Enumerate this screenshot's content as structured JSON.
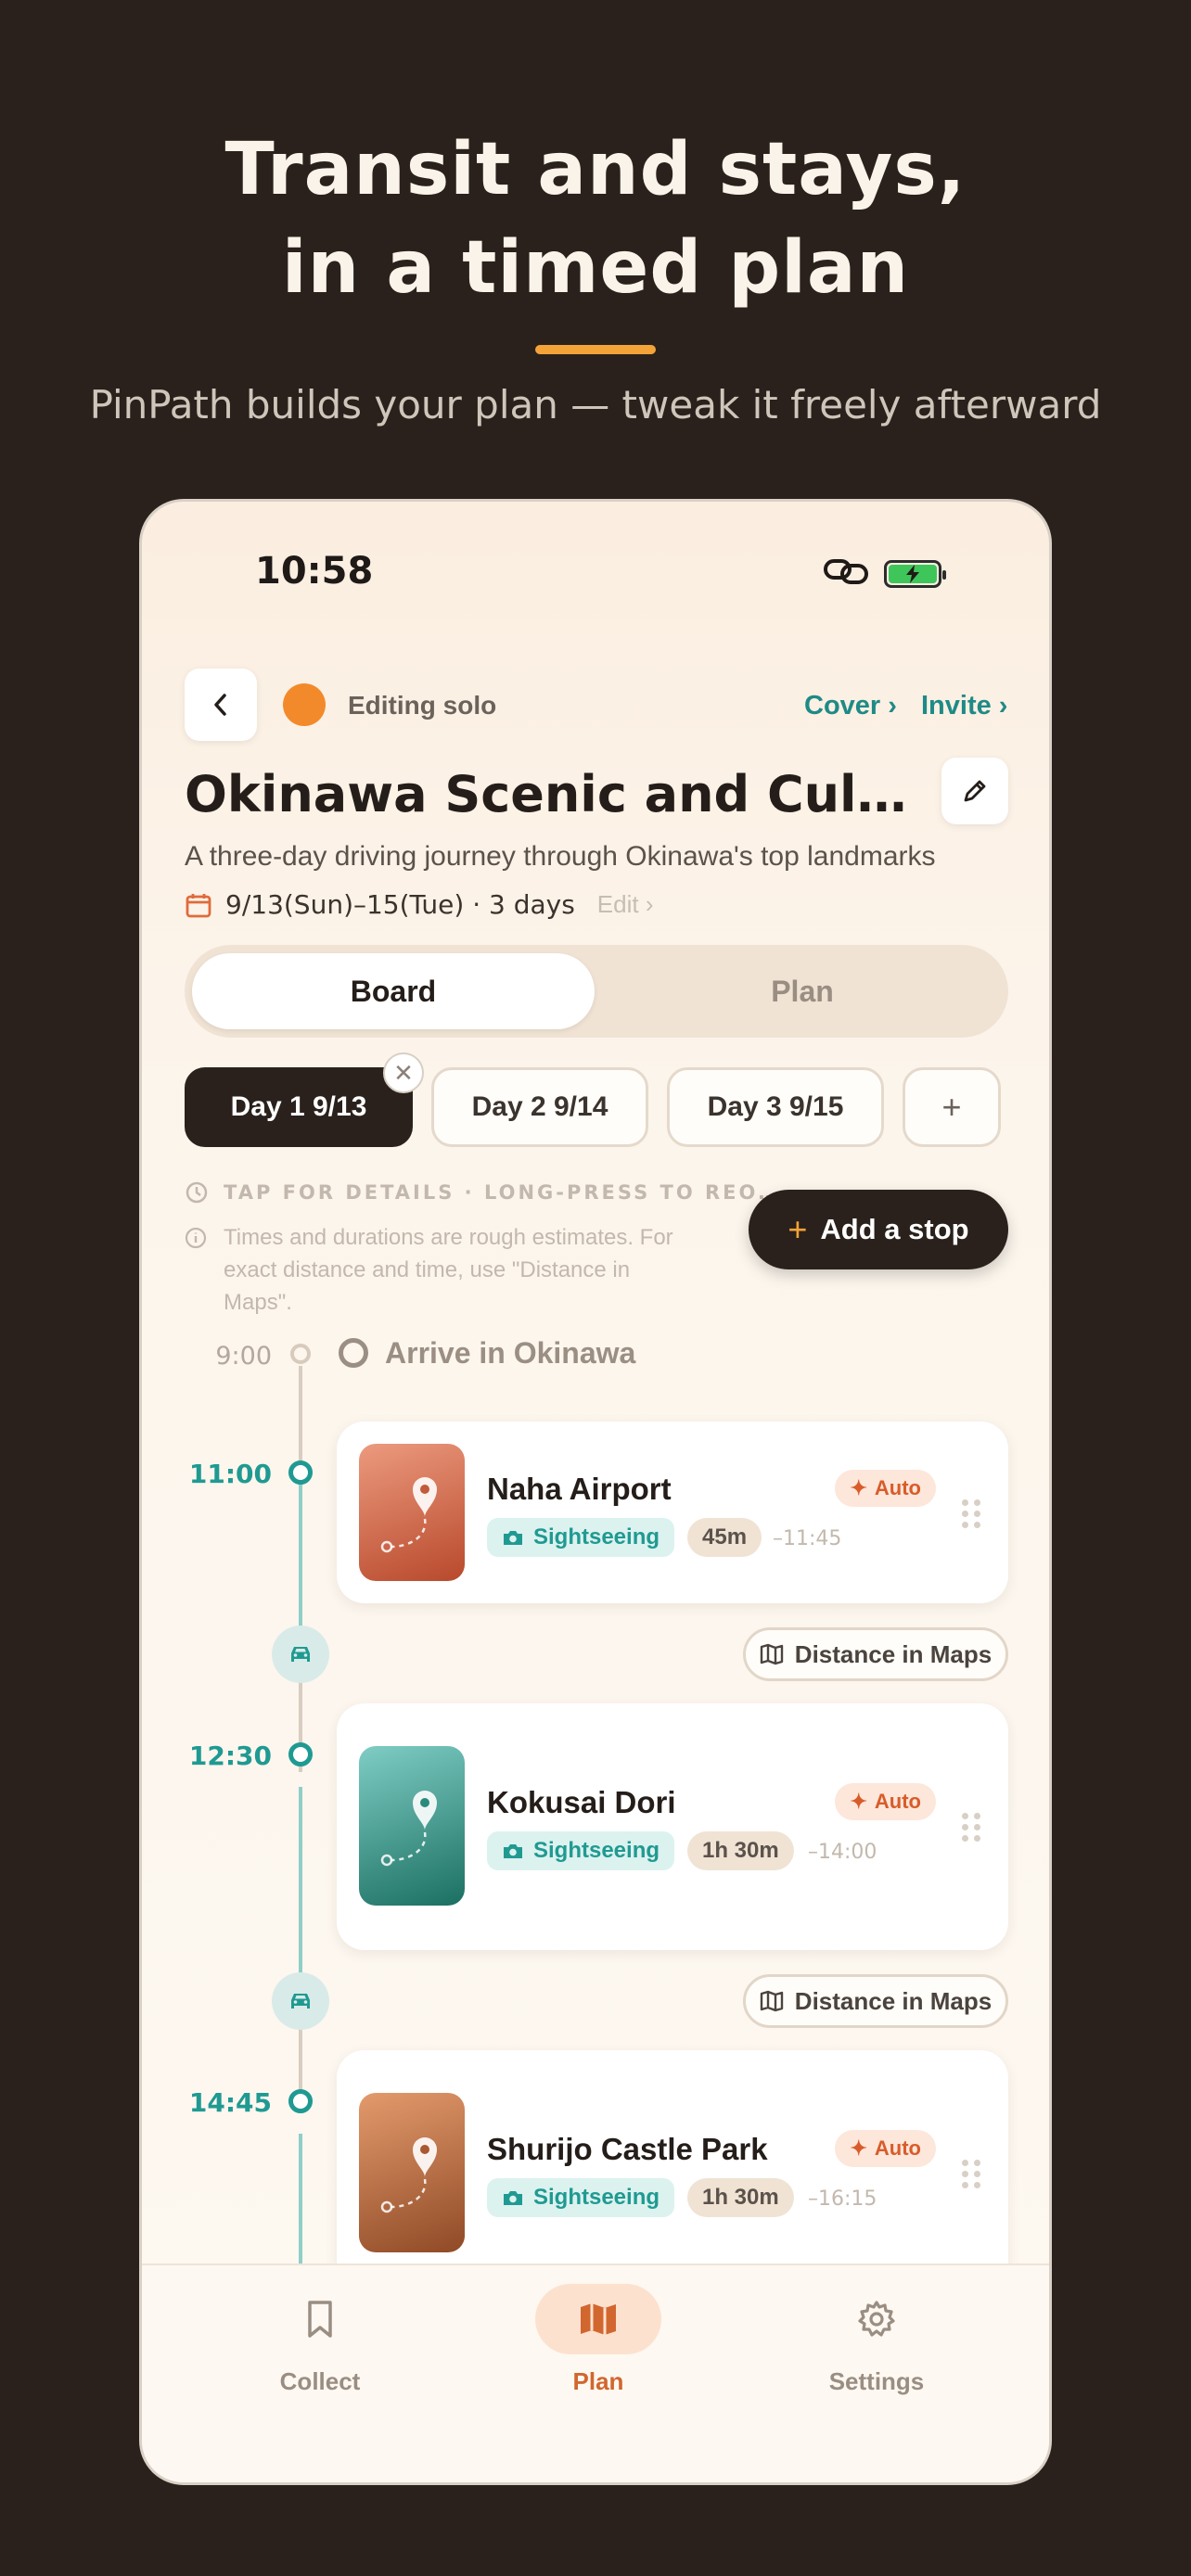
{
  "hero": {
    "title_line1": "Transit and stays,",
    "title_line2": "in a timed plan",
    "subtitle": "PinPath builds your plan — tweak it freely afterward"
  },
  "status": {
    "time": "10:58"
  },
  "header": {
    "editing": "Editing solo",
    "cover": "Cover ›",
    "invite": "Invite ›"
  },
  "trip": {
    "title": "Okinawa Scenic and Cultural Tour",
    "description": "A three-day driving journey through Okinawa's top landmarks",
    "dates": "9/13(Sun)–15(Tue) · 3 days",
    "edit": "Edit ›"
  },
  "segment": {
    "board": "Board",
    "plan": "Plan"
  },
  "days": [
    {
      "label": "Day 1 9/13"
    },
    {
      "label": "Day 2 9/14"
    },
    {
      "label": "Day 3 9/15"
    }
  ],
  "add_day": "+",
  "hints": {
    "tap": "TAP FOR DETAILS · LONG-PRESS TO REO…",
    "estimate": "Times and durations are rough estimates. For exact distance and time, use \"Distance in Maps\"."
  },
  "add_stop": "Add a stop",
  "arrival": {
    "time": "9:00",
    "label": "Arrive in Okinawa"
  },
  "stops": [
    {
      "time": "11:00",
      "name": "Naha Airport",
      "badge": "Auto",
      "category": "Sightseeing",
      "duration": "45m",
      "end": "–11:45"
    },
    {
      "time": "12:30",
      "name": "Kokusai Dori",
      "badge": "Auto",
      "category": "Sightseeing",
      "duration": "1h 30m",
      "end": "–14:00"
    },
    {
      "time": "14:45",
      "name": "Shurijo Castle Park",
      "badge": "Auto",
      "category": "Sightseeing",
      "duration": "1h 30m",
      "end": "–16:15"
    }
  ],
  "maps_button": "Distance in Maps",
  "nav": {
    "collect": "Collect",
    "plan": "Plan",
    "settings": "Settings"
  },
  "colors": {
    "accent_teal": "#1f9a92",
    "dark": "#2a211c",
    "orange": "#f4a338",
    "auto_orange": "#d85c2a"
  },
  "icons": [
    "chevron-left-icon",
    "pencil-icon",
    "calendar-icon",
    "clock-icon",
    "info-icon",
    "car-icon",
    "map-icon",
    "camera-icon",
    "sparkle-icon",
    "bookmark-icon",
    "gear-icon",
    "link-icon",
    "battery-icon"
  ]
}
